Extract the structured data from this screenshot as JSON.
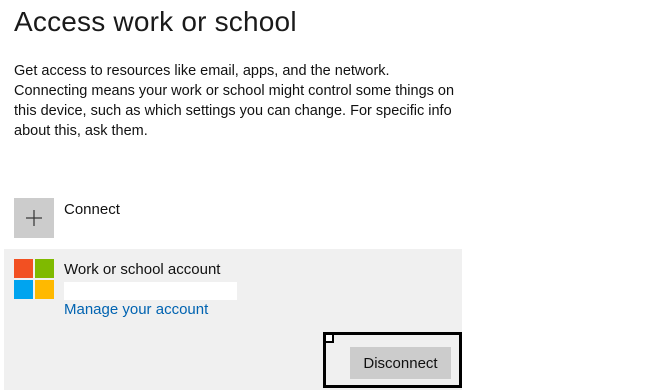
{
  "page": {
    "title": "Access work or school",
    "description": "Get access to resources like email, apps, and the network. Connecting means your work or school might control some things on this device, such as which settings you can change. For specific info about this, ask them."
  },
  "connect": {
    "label": "Connect",
    "icon": "plus-icon"
  },
  "account": {
    "name": "Work or school account",
    "logo": "microsoft-logo",
    "manage_link": "Manage your account",
    "disconnect_label": "Disconnect"
  },
  "colors": {
    "accent_link": "#0063b1",
    "card_background": "#f0f0f0",
    "tile_background": "#cccccc",
    "logo_red": "#f25022",
    "logo_green": "#7fba00",
    "logo_blue": "#00a4ef",
    "logo_yellow": "#ffb900"
  }
}
